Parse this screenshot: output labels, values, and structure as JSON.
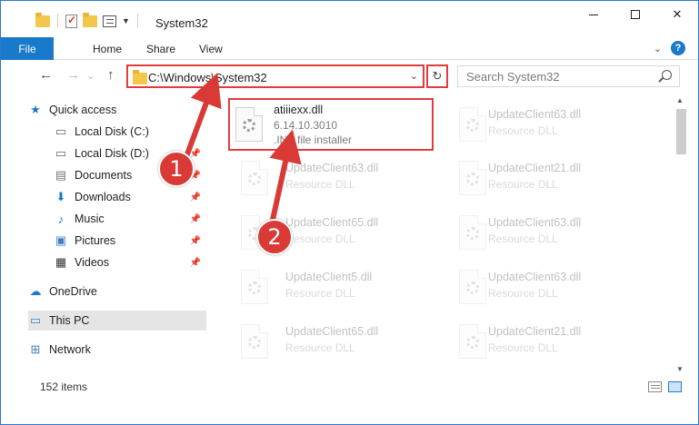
{
  "window": {
    "title": "System32",
    "controls": {
      "minimize": "",
      "maximize": "",
      "close": "✕"
    }
  },
  "ribbon": {
    "tabs": [
      "File",
      "Home",
      "Share",
      "View"
    ],
    "collapse_icon": "chevron-down-icon",
    "help": "?"
  },
  "address": {
    "path": "C:\\Windows\\System32",
    "refresh": "↻"
  },
  "search": {
    "placeholder": "Search System32"
  },
  "nav": {
    "back": "←",
    "forward": "→",
    "up": "↑",
    "recent": "⌄"
  },
  "sidebar": {
    "items": [
      {
        "label": "Quick access",
        "icon": "star-icon",
        "pinned": false
      },
      {
        "label": "Local Disk (C:)",
        "icon": "drive-icon",
        "pinned": false
      },
      {
        "label": "Local Disk (D:)",
        "icon": "drive-icon",
        "pinned": true
      },
      {
        "label": "Documents",
        "icon": "documents-icon",
        "pinned": true
      },
      {
        "label": "Downloads",
        "icon": "download-icon",
        "pinned": true
      },
      {
        "label": "Music",
        "icon": "music-icon",
        "pinned": true
      },
      {
        "label": "Pictures",
        "icon": "pictures-icon",
        "pinned": true
      },
      {
        "label": "Videos",
        "icon": "videos-icon",
        "pinned": true
      },
      {
        "label": "OneDrive",
        "icon": "cloud-icon",
        "pinned": false
      },
      {
        "label": "This PC",
        "icon": "computer-icon",
        "pinned": false,
        "selected": true
      },
      {
        "label": "Network",
        "icon": "network-icon",
        "pinned": false
      }
    ]
  },
  "files": {
    "highlighted": {
      "name": "atiiiexx.dll",
      "version": "6.14.10.3010",
      "type": ".INF file installer"
    },
    "items": [
      {
        "name": "UpdateClient63.dll",
        "type": "Resource DLL"
      },
      {
        "name": "UpdateClient63.dll",
        "type": "Resource DLL"
      },
      {
        "name": "UpdateClient21.dll",
        "type": "Resource DLL"
      },
      {
        "name": "UpdateClient65.dll",
        "type": "Resource DLL"
      },
      {
        "name": "UpdateClient63.dll",
        "type": "Resource DLL"
      },
      {
        "name": "UpdateClient5.dll",
        "type": "Resource DLL"
      },
      {
        "name": "UpdateClient63.dll",
        "type": "Resource DLL"
      },
      {
        "name": "UpdateClient65.dll",
        "type": "Resource DLL"
      },
      {
        "name": "UpdateClient21.dll",
        "type": "Resource DLL"
      }
    ]
  },
  "status": {
    "count": "152 items"
  },
  "annotations": {
    "step1": "1",
    "step2": "2"
  },
  "colors": {
    "accent": "#1979ca",
    "highlight": "#e23b3b",
    "badge": "#d93a35"
  }
}
